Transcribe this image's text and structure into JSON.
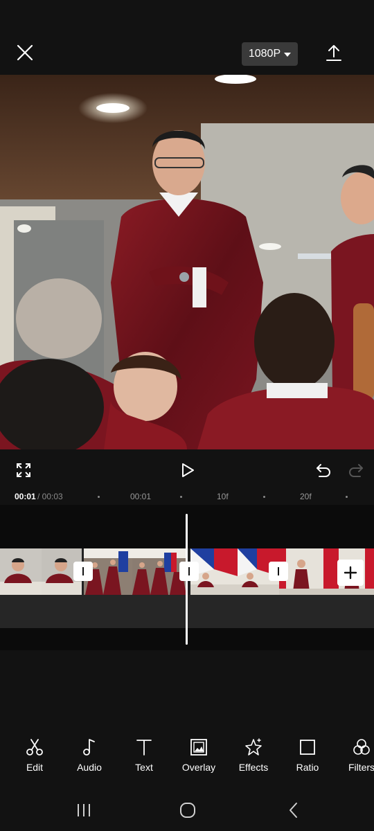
{
  "top_bar": {
    "resolution_label": "1080P",
    "icons": {
      "close": "close-icon",
      "export": "export-upload-icon"
    }
  },
  "preview": {
    "image": "video frame: judges in maroon robes in a courtroom"
  },
  "controls": {
    "icons": {
      "fullscreen": "fullscreen-icon",
      "play": "play-icon",
      "undo": "undo-icon",
      "redo": "redo-icon"
    }
  },
  "timeline": {
    "current_time": "00:01",
    "total_time": "/ 00:03",
    "ticks": [
      "00:01",
      "10f",
      "20f"
    ]
  },
  "tools": [
    {
      "label": "Edit",
      "icon": "scissors-icon"
    },
    {
      "label": "Audio",
      "icon": "music-note-icon"
    },
    {
      "label": "Text",
      "icon": "text-icon"
    },
    {
      "label": "Overlay",
      "icon": "overlay-icon"
    },
    {
      "label": "Effects",
      "icon": "effects-star-icon"
    },
    {
      "label": "Ratio",
      "icon": "ratio-icon"
    },
    {
      "label": "Filters",
      "icon": "filters-icon"
    }
  ],
  "navbar": {
    "icons": [
      "recent-apps-icon",
      "home-icon",
      "back-icon"
    ]
  },
  "colors": {
    "background": "#121212",
    "robe": "#7a1520",
    "flag_blue": "#1f3fa0",
    "flag_red": "#c8192c"
  }
}
